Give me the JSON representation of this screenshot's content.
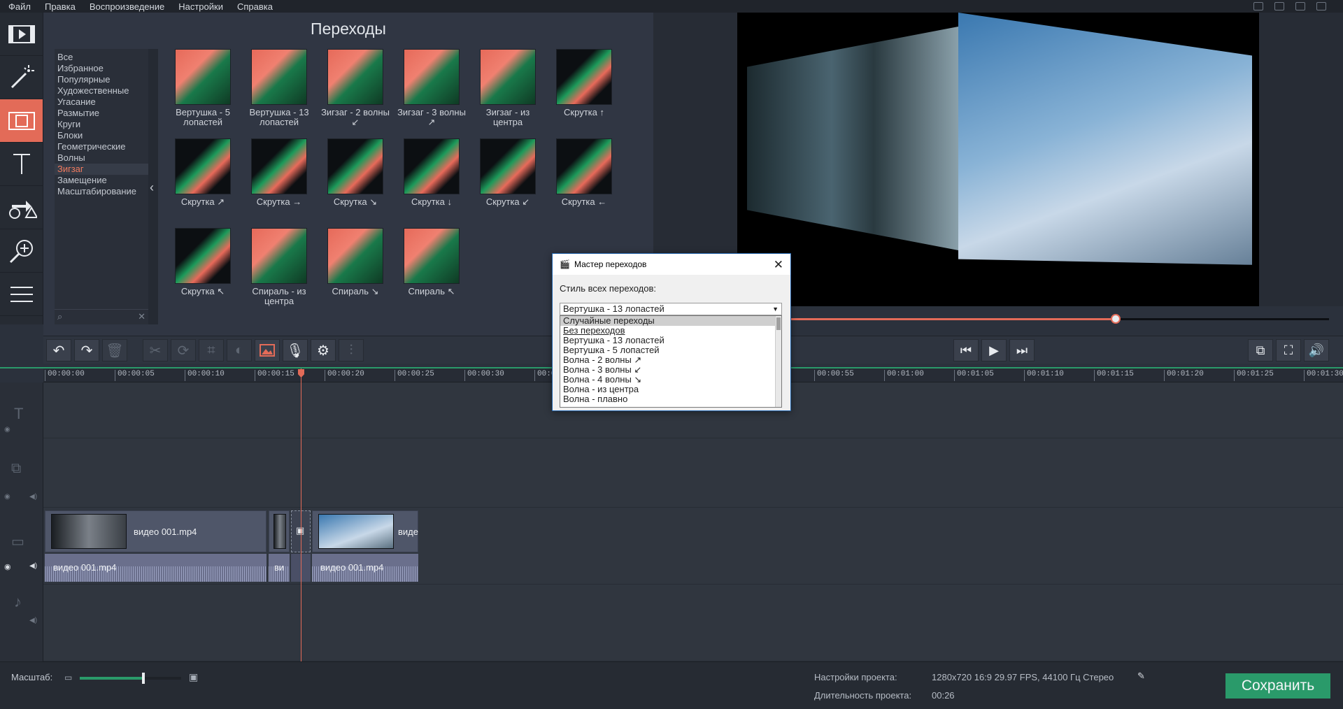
{
  "menu": {
    "items": [
      "Файл",
      "Правка",
      "Воспроизведение",
      "Настройки",
      "Справка"
    ]
  },
  "left_tools": [
    "import-icon",
    "magic-wand-icon",
    "transitions-icon",
    "text-icon",
    "shapes-icon",
    "zoom-icon",
    "list-icon"
  ],
  "transitions_panel": {
    "title": "Переходы",
    "categories": [
      "Все",
      "Избранное",
      "Популярные",
      "Художественные",
      "Угасание",
      "Размытие",
      "Круги",
      "Блоки",
      "Геометрические",
      "Волны",
      "Зигзаг",
      "Замещение",
      "Масштабирование"
    ],
    "selected_category": "Зигзаг",
    "tiles": [
      "Вертушка - 5 лопастей",
      "Вертушка - 13 лопастей",
      "Зигзаг - 2 волны ↙",
      "Зигзаг - 3 волны ↗",
      "Зигзаг - из центра",
      "Скрутка ↑",
      "Скрутка ↗",
      "Скрутка →",
      "Скрутка ↘",
      "Скрутка ↓",
      "Скрутка ↙",
      "Скрутка ←",
      "Скрутка ↖",
      "Спираль - из центра",
      "Спираль ↘",
      "Спираль ↖"
    ]
  },
  "preview": {
    "progress": 0.61
  },
  "timeline": {
    "ticks": [
      "00:00:00",
      "00:00:05",
      "00:00:10",
      "00:00:15",
      "00:00:20",
      "00:00:25",
      "00:00:30",
      "00:0",
      "00:00:55",
      "00:01:00",
      "00:01:05",
      "00:01:10",
      "00:01:15",
      "00:01:20",
      "00:01:25",
      "00:01:30"
    ],
    "clips": {
      "video_a": "видео 001.mp4",
      "video_b": "видео 001.mp4",
      "video_c_partial": "виде",
      "audio_a": "видео 001.mp4",
      "audio_b_partial": "ви",
      "audio_c": "видео 001.mp4"
    }
  },
  "bottom": {
    "scale_label": "Масштаб:",
    "zoom_level": 0.63,
    "project_settings_label": "Настройки проекта:",
    "project_settings_value": "1280x720 16:9 29.97 FPS, 44100 Гц Стерео",
    "project_duration_label": "Длительность проекта:",
    "project_duration_value": "00:26",
    "save_label": "Сохранить"
  },
  "dialog": {
    "title": "Мастер переходов",
    "label": "Стиль всех переходов:",
    "selected": "Вертушка - 13 лопастей",
    "options": [
      "Случайные переходы",
      "Без переходов",
      "Вертушка - 13 лопастей",
      "Вертушка - 5 лопастей",
      "Волна - 2 волны ↗",
      "Волна - 3 волны ↙",
      "Волна - 4 волны ↘",
      "Волна - из центра",
      "Волна - плавно"
    ]
  },
  "colors": {
    "accent": "#e36b58",
    "green": "#2a9a6a",
    "panel": "#303643"
  }
}
